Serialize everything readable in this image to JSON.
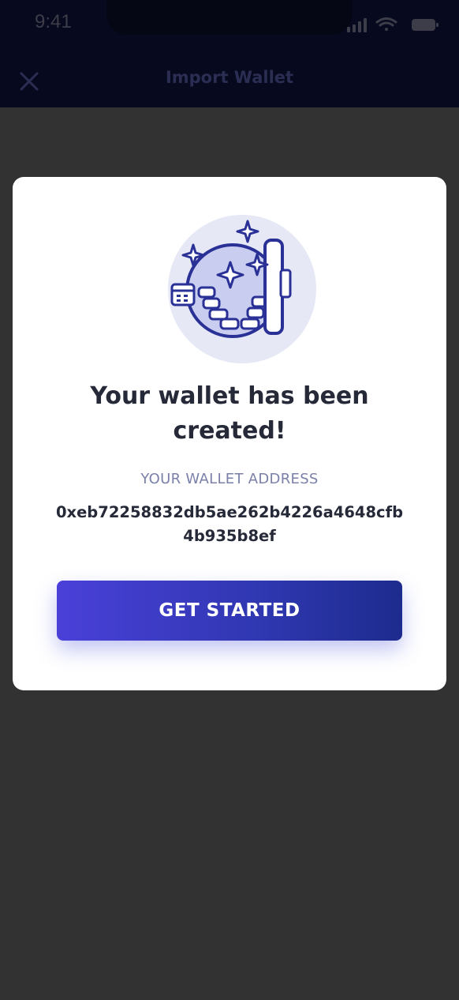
{
  "status_bar": {
    "time": "9:41"
  },
  "header": {
    "title": "Import Wallet"
  },
  "modal": {
    "heading": "Your wallet has been created!",
    "address_label": "YOUR WALLET ADDRESS",
    "address": "0xeb72258832db5ae262b4226a4648cfb4b935b8ef",
    "button_label": "GET STARTED"
  },
  "colors": {
    "header_bg": "#070a1f",
    "overlay_bg": "#323232",
    "accent_start": "#4a40d9",
    "accent_end": "#1d2b8e"
  }
}
